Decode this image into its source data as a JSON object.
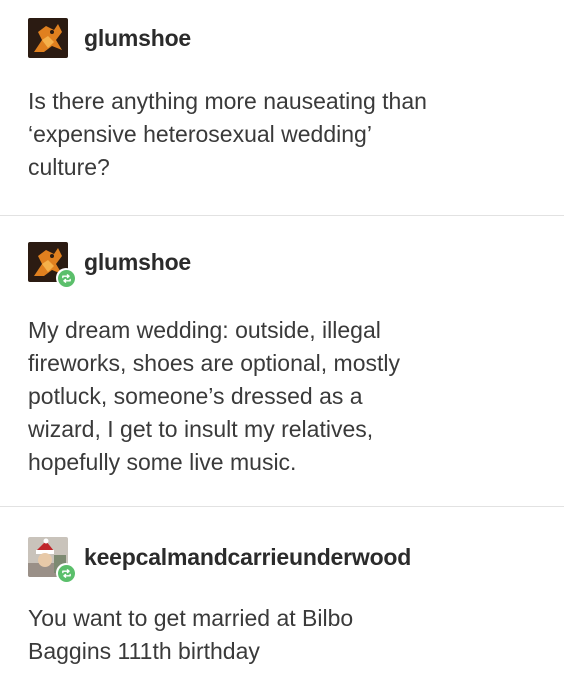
{
  "posts": [
    {
      "username": "glumshoe",
      "avatar": "glumshoe-avatar",
      "reblog": false,
      "text": "Is there anything more nauseating than\n‘expensive heterosexual wedding’\nculture?"
    },
    {
      "username": "glumshoe",
      "avatar": "glumshoe-avatar",
      "reblog": true,
      "text": "My dream wedding: outside, illegal\nfireworks, shoes are optional, mostly\npotluck, someone’s dressed as a\nwizard, I get to insult my relatives,\nhopefully some live music."
    },
    {
      "username": "keepcalmandcarrieunderwood",
      "avatar": "keepcalmandcarrieunderwood-avatar",
      "reblog": true,
      "text": "You want to get married at Bilbo\nBaggins 111th birthday"
    }
  ],
  "colors": {
    "reblog_badge": "#5bbf6b",
    "divider": "#e2e2e2",
    "text": "#3a3a3a"
  },
  "icons": {
    "reblog": "reblog-icon"
  }
}
